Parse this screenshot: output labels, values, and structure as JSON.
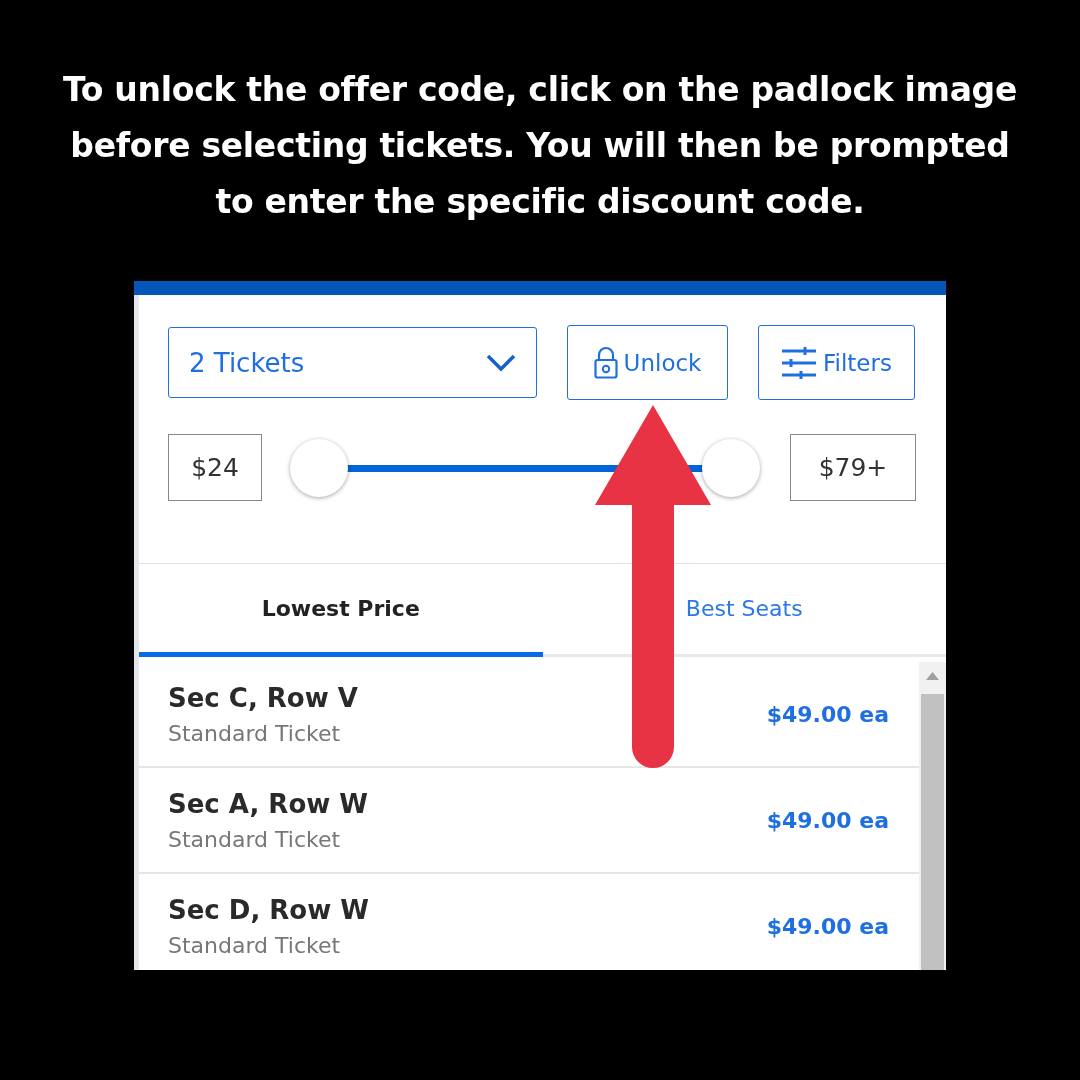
{
  "instruction": "To unlock the offer code, click on the padlock image before selecting tickets. You will then be prompted to enter the specific discount code.",
  "toolbar": {
    "quantity": "2 Tickets",
    "unlock_button": "Unlock",
    "filters_button": "Filters"
  },
  "price_range": {
    "min": "$24",
    "max": "$79+",
    "thumbs": [
      {
        "level": 0
      },
      {
        "level": 1
      }
    ]
  },
  "tabs": [
    {
      "label": "Lowest Price",
      "selected": true
    },
    {
      "label": "Best Seats",
      "selected": false
    }
  ],
  "listings": [
    {
      "seat": "Sec C, Row V",
      "type": "Standard Ticket",
      "price": "$49.00 ea"
    },
    {
      "seat": "Sec A, Row W",
      "type": "Standard Ticket",
      "price": "$49.00 ea"
    },
    {
      "seat": "Sec D, Row W",
      "type": "Standard Ticket",
      "price": "$49.00 ea"
    }
  ]
}
